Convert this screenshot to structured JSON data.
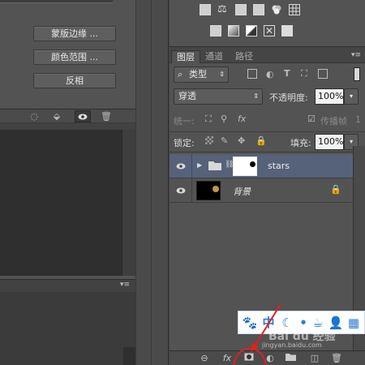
{
  "left_panel": {
    "buttons": [
      "蒙版边缘 ...",
      "颜色范围 ...",
      "反相"
    ],
    "bottom_icons": [
      "selection-circle-icon",
      "apply-mask-icon",
      "eye-icon",
      "trash-icon"
    ]
  },
  "adjustments": {
    "icons": [
      "levels-icon",
      "balance-icon",
      "hue-icon",
      "color-lookup-icon",
      "channel-mixer-icon",
      "grid-icon",
      "invert-icon",
      "gradient-icon",
      "threshold-icon",
      "selective-color-icon",
      "solid-color-icon"
    ]
  },
  "layers_panel": {
    "tabs": [
      "图层",
      "通道",
      "路径"
    ],
    "active_tab": "图层",
    "filter_label": "类型",
    "blend_mode": "穿透",
    "opacity_label": "不透明度:",
    "opacity_value": "100%",
    "unify_label": "统一:",
    "propagate_label": "传播帧",
    "propagate_count": "1",
    "lock_label": "锁定:",
    "fill_label": "填充:",
    "fill_value": "100%",
    "layers": [
      {
        "name": "stars",
        "type": "group",
        "selected": true
      },
      {
        "name": "背景",
        "type": "background",
        "locked": true
      }
    ],
    "footer_icons": [
      "link-icon",
      "fx-icon",
      "add-mask-icon",
      "adjustment-icon",
      "group-icon",
      "new-layer-icon",
      "trash-icon"
    ]
  },
  "overlay": {
    "baidu_icons": [
      "paw-icon",
      "zhong-icon",
      "moon-icon",
      "dot-icon",
      "cup-icon",
      "user-icon",
      "apps-icon"
    ],
    "watermark": "Bai du 经验",
    "watermark_url": "jingyan.baidu.com"
  },
  "colors": {
    "selected_row": "#55627a",
    "panel": "#535353",
    "annotation": "#e0201e"
  }
}
